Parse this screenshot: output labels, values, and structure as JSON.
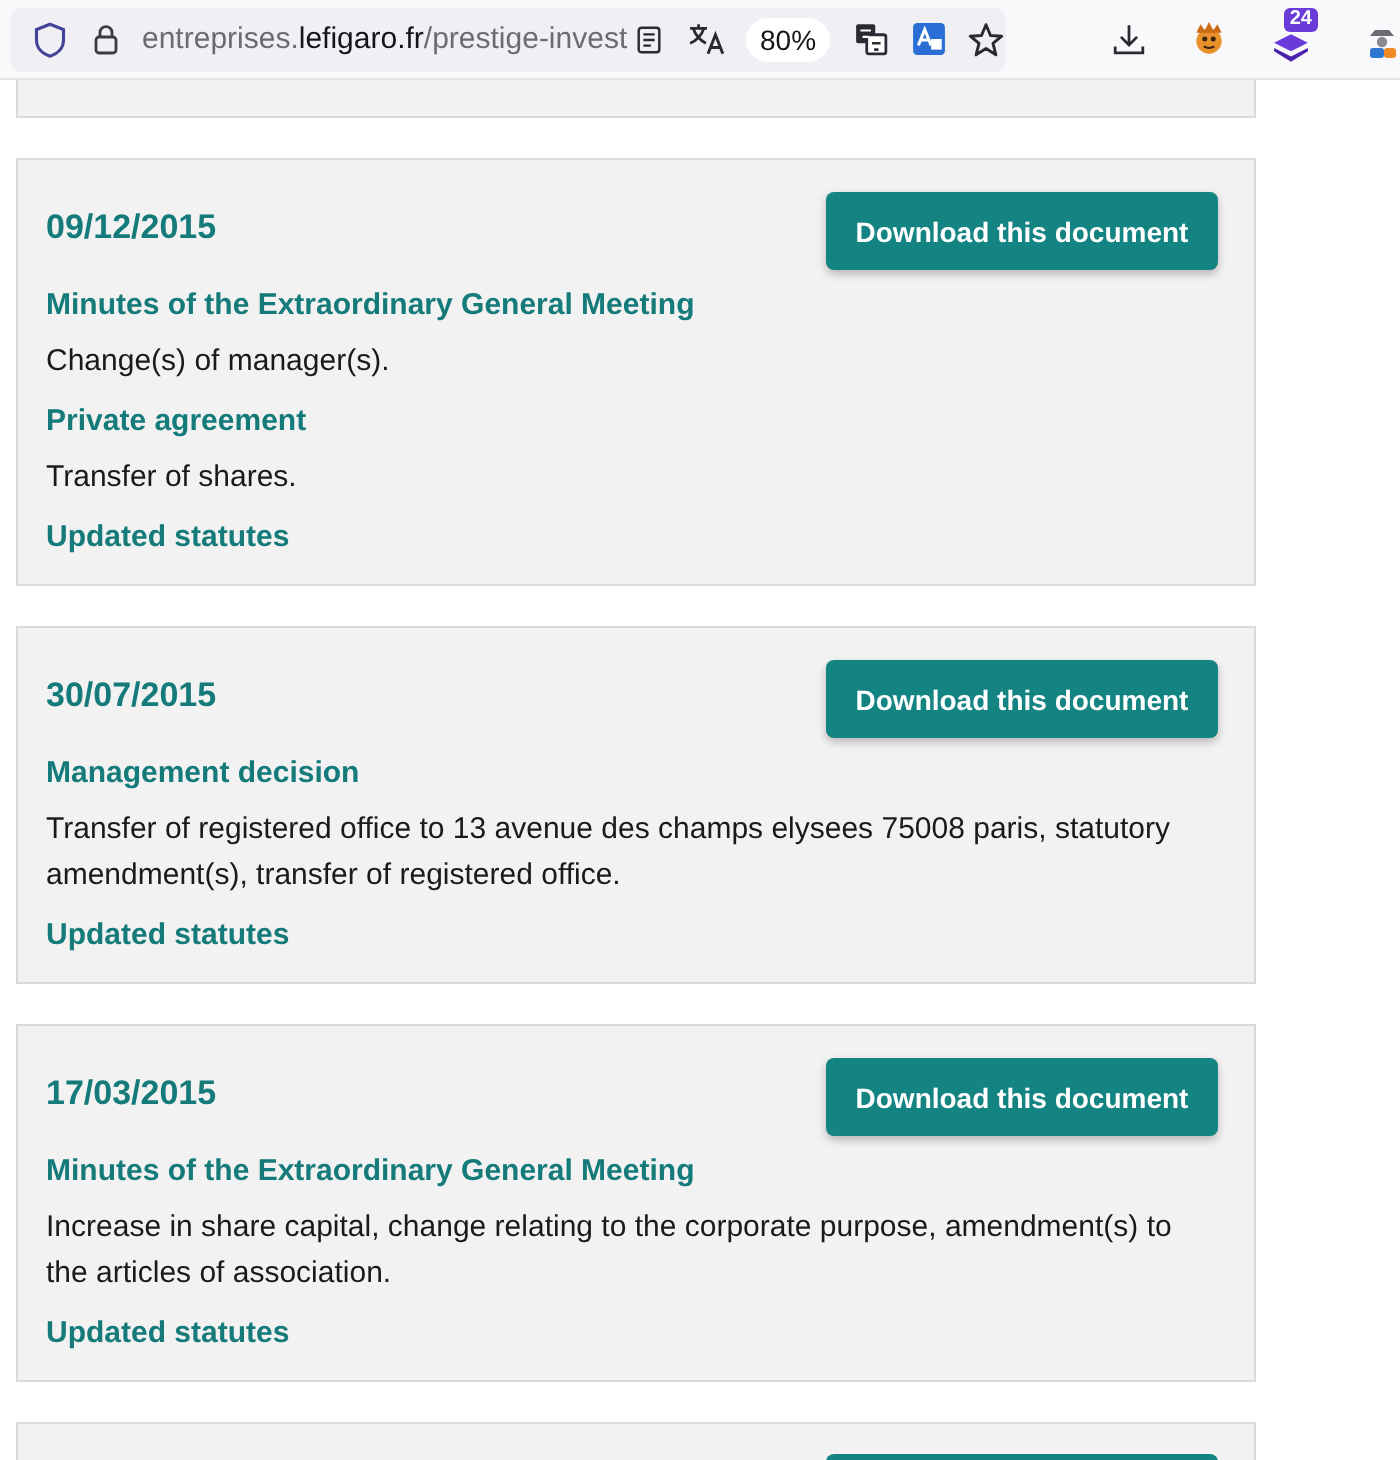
{
  "browser": {
    "url": {
      "subdomain": "entreprises.",
      "domain": "lefigaro.fr",
      "path": "/prestige-invest"
    },
    "zoom_level": "80%",
    "extension_badge": "24"
  },
  "cards": [
    {
      "date": "09/12/2015",
      "button": "Download this document",
      "entries": [
        {
          "title": "Minutes of the Extraordinary General Meeting",
          "description": "Change(s) of manager(s)."
        },
        {
          "title": "Private agreement",
          "description": "Transfer of shares."
        },
        {
          "title": "Updated statutes"
        }
      ]
    },
    {
      "date": "30/07/2015",
      "button": "Download this document",
      "entries": [
        {
          "title": "Management decision",
          "description": "Transfer of registered office to 13 avenue des champs elysees 75008 paris, statutory amendment(s), transfer of registered office."
        },
        {
          "title": "Updated statutes"
        }
      ]
    },
    {
      "date": "17/03/2015",
      "button": "Download this document",
      "entries": [
        {
          "title": "Minutes of the Extraordinary General Meeting",
          "description": "Increase in share capital, change relating to the corporate purpose, amendment(s) to the articles of association."
        },
        {
          "title": "Updated statutes"
        }
      ]
    }
  ]
}
